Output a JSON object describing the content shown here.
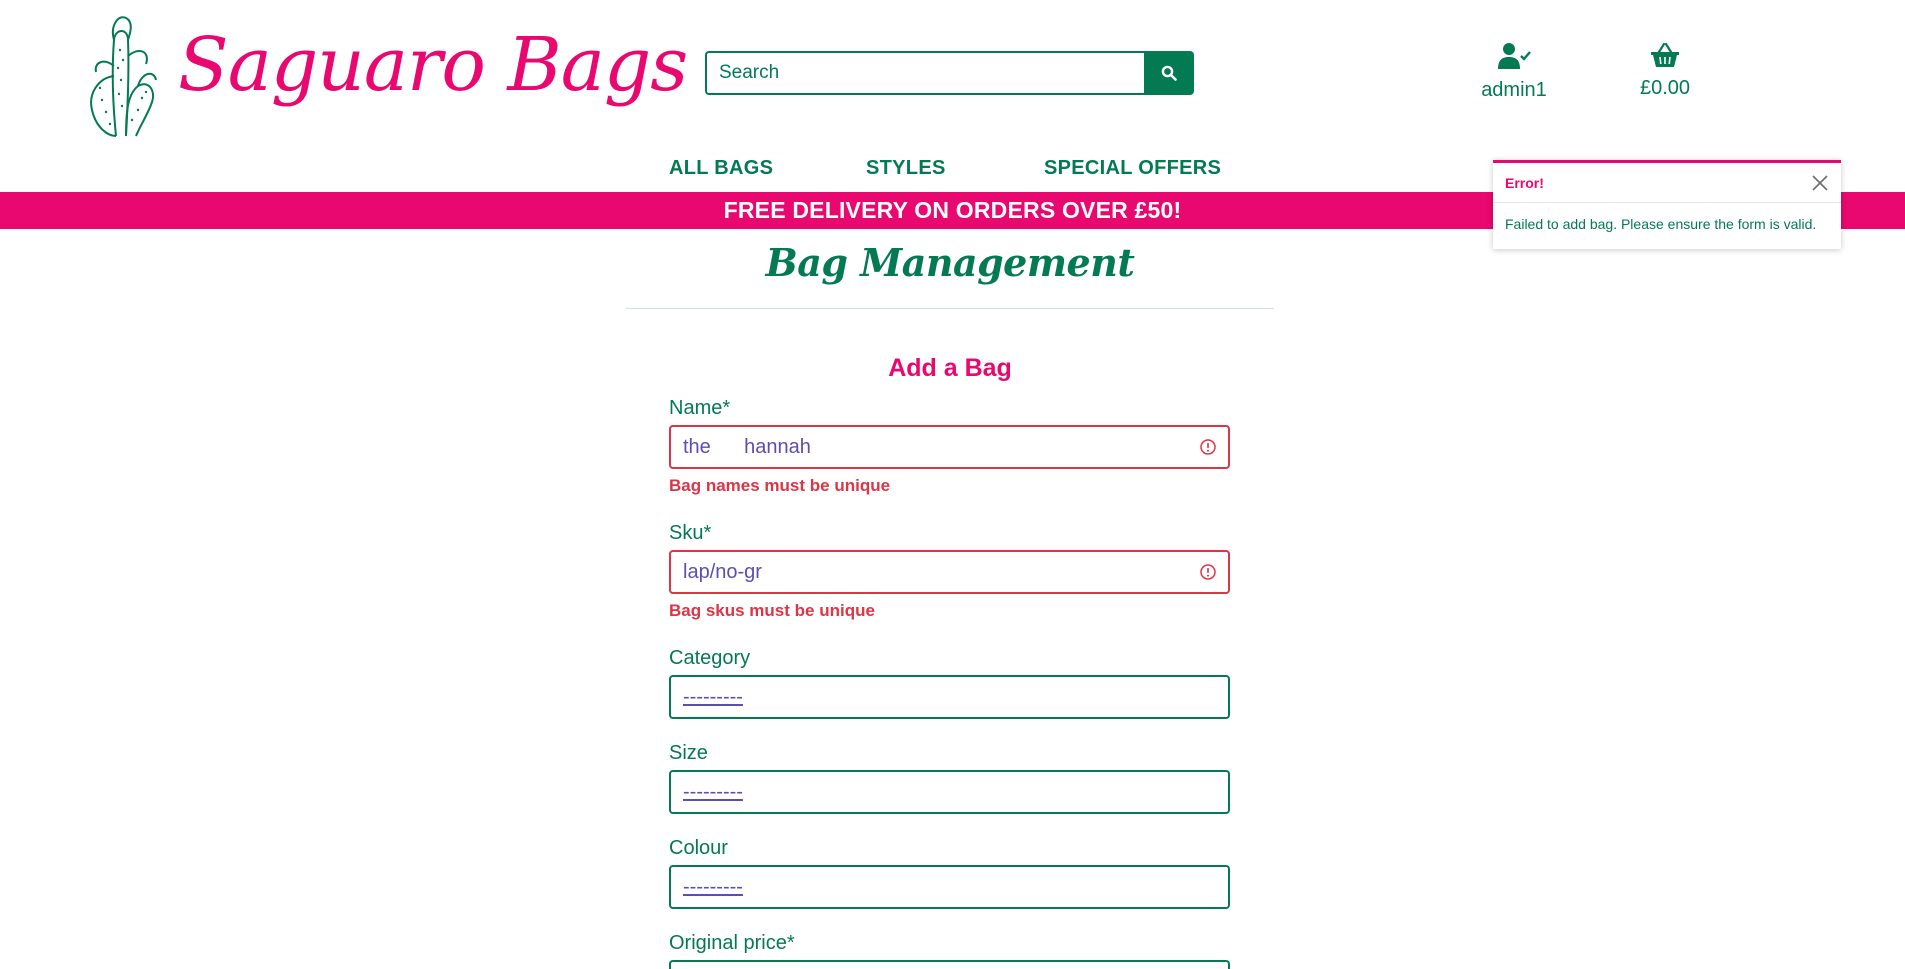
{
  "header": {
    "logo_text": "Saguaro Bags",
    "search": {
      "placeholder": "Search",
      "value": ""
    },
    "account_label": "admin1",
    "cart_total": "£0.00"
  },
  "nav": {
    "items": [
      "ALL BAGS",
      "STYLES",
      "SPECIAL OFFERS"
    ]
  },
  "banner": {
    "text": "FREE DELIVERY ON ORDERS OVER £50!"
  },
  "toast": {
    "title": "Error!",
    "message": "Failed to add bag. Please ensure the form is valid."
  },
  "page": {
    "title": "Bag Management",
    "form_title": "Add a Bag"
  },
  "form": {
    "name": {
      "label": "Name*",
      "value": "the      hannah",
      "error": "Bag names must be unique"
    },
    "sku": {
      "label": "Sku*",
      "value": "lap/no-gr",
      "error": "Bag skus must be unique"
    },
    "category": {
      "label": "Category",
      "value": "---------"
    },
    "size": {
      "label": "Size",
      "value": "---------"
    },
    "colour": {
      "label": "Colour",
      "value": "---------"
    },
    "original_price": {
      "label": "Original price*"
    }
  },
  "colors": {
    "brand_green": "#047a52",
    "brand_pink": "#e8086f",
    "error_red": "#dc3545"
  },
  "icons": [
    "cactus-logo-icon",
    "search-icon",
    "user-check-icon",
    "basket-icon",
    "close-icon",
    "error-icon"
  ]
}
